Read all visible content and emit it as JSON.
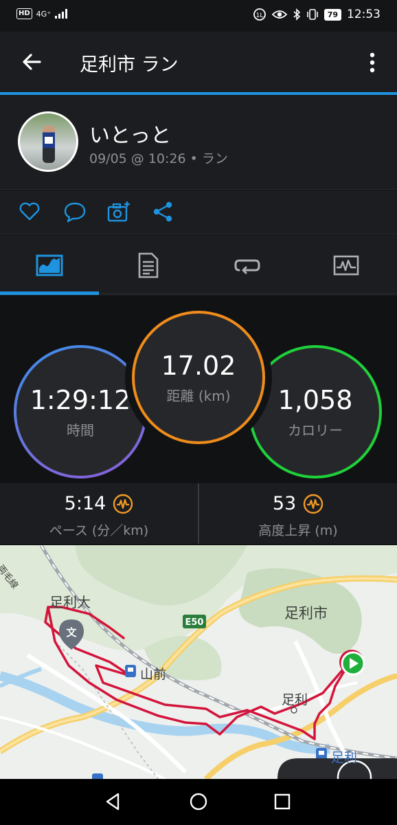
{
  "status_bar": {
    "network": "HD",
    "signal": "4G⁺",
    "battery": "79",
    "time": "12:53"
  },
  "app_bar": {
    "title": "足利市 ラン"
  },
  "profile": {
    "name": "いとっと",
    "meta": "09/05 @ 10:26 • ラン"
  },
  "stats": {
    "time_value": "1:29:12",
    "time_label": "時間",
    "distance_value": "17.02",
    "distance_label": "距離 (km)",
    "calories_value": "1,058",
    "calories_label": "カロリー"
  },
  "metrics": {
    "pace_value": "5:14",
    "pace_label": "ペース (分／km)",
    "elevation_value": "53",
    "elevation_label": "高度上昇 (m)"
  },
  "map": {
    "labels": {
      "railway": "両毛線",
      "univ": "足利大",
      "city": "足利市",
      "yamamae": "山前",
      "ashikaga": "足利",
      "ashikaga_station": "足利",
      "expressway": "E50"
    }
  },
  "colors": {
    "accent_blue": "#1e94e0",
    "ring_time": "#5a6fd8",
    "ring_distance": "#ef8c1b",
    "ring_calories": "#1fd13a",
    "icon_orange": "#f39a27",
    "route_red": "#d3143b"
  }
}
